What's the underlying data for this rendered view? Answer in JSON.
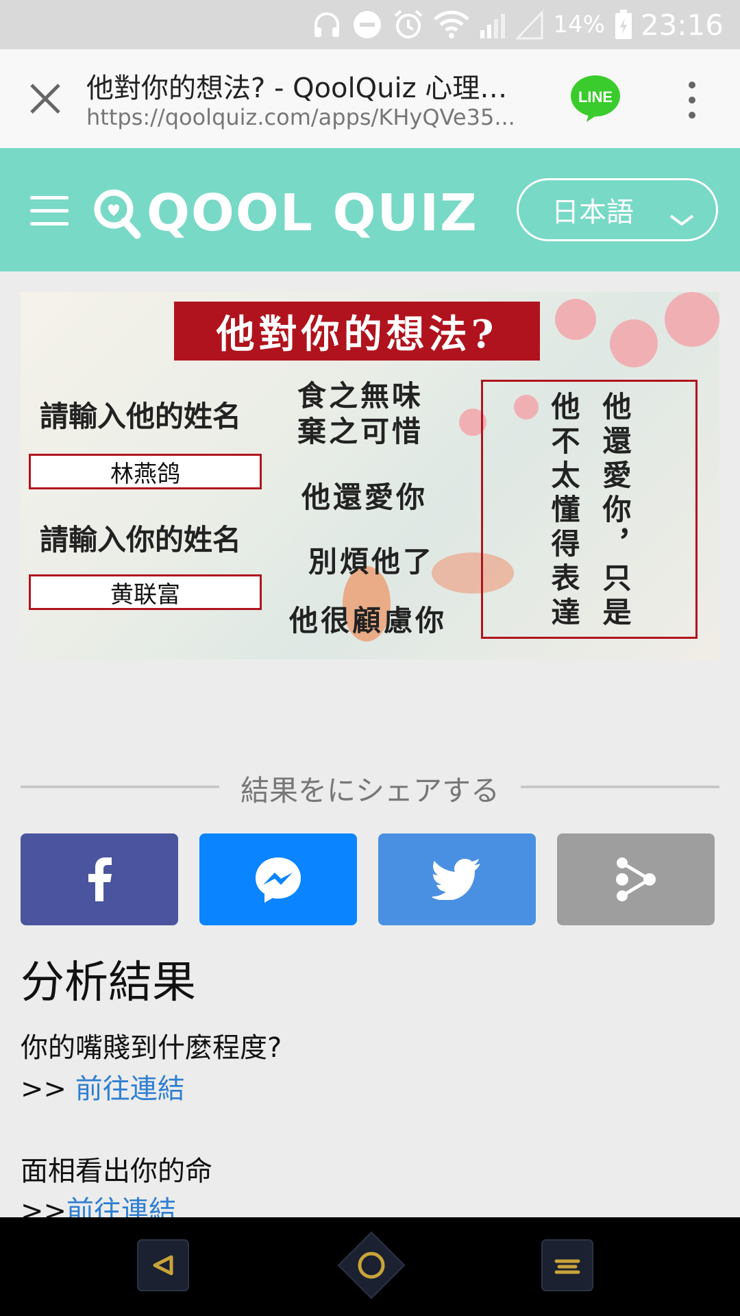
{
  "status_bar": {
    "battery": "14%",
    "time": "23:16",
    "icons": [
      "headphones-icon",
      "do-not-disturb-icon",
      "alarm-icon",
      "wifi-icon",
      "signal-icon",
      "signal-empty-icon",
      "battery-charging-icon"
    ]
  },
  "browser": {
    "title": "他對你的想法? - QoolQuiz 心理テ...",
    "url": "https://qoolquiz.com/apps/KHyQVe35...",
    "line_label": "LINE"
  },
  "site": {
    "logo_text": "QOOL QUIZ",
    "language": "日本語"
  },
  "banner": {
    "title": "他對你的想法?",
    "label_his_name": "請輸入他的姓名",
    "his_name": "林燕鸽",
    "label_your_name": "請輸入你的姓名",
    "your_name": "黄联富",
    "phrase1_line1": "食之無味",
    "phrase1_line2": "棄之可惜",
    "phrase2": "他還愛你",
    "phrase3": "別煩他了",
    "phrase4": "他很顧慮你",
    "vertical_col1": "他還愛你，只是",
    "vertical_col2": "他不太懂得表達"
  },
  "share": {
    "label": "結果をにシェアする",
    "buttons": [
      {
        "name": "facebook",
        "color": "#4b559f"
      },
      {
        "name": "messenger",
        "color": "#0a84ff"
      },
      {
        "name": "twitter",
        "color": "#4a90e2"
      },
      {
        "name": "share",
        "color": "#9e9e9e"
      }
    ]
  },
  "analysis": {
    "title": "分析結果",
    "items": [
      {
        "question": "你的嘴賤到什麼程度?",
        "prefix": ">> ",
        "link": "前往連結"
      },
      {
        "question": "面相看出你的命",
        "prefix": ">>",
        "link": "前往連結"
      }
    ]
  },
  "nav": {
    "buttons": [
      "back-icon",
      "home-icon",
      "recents-icon"
    ]
  }
}
